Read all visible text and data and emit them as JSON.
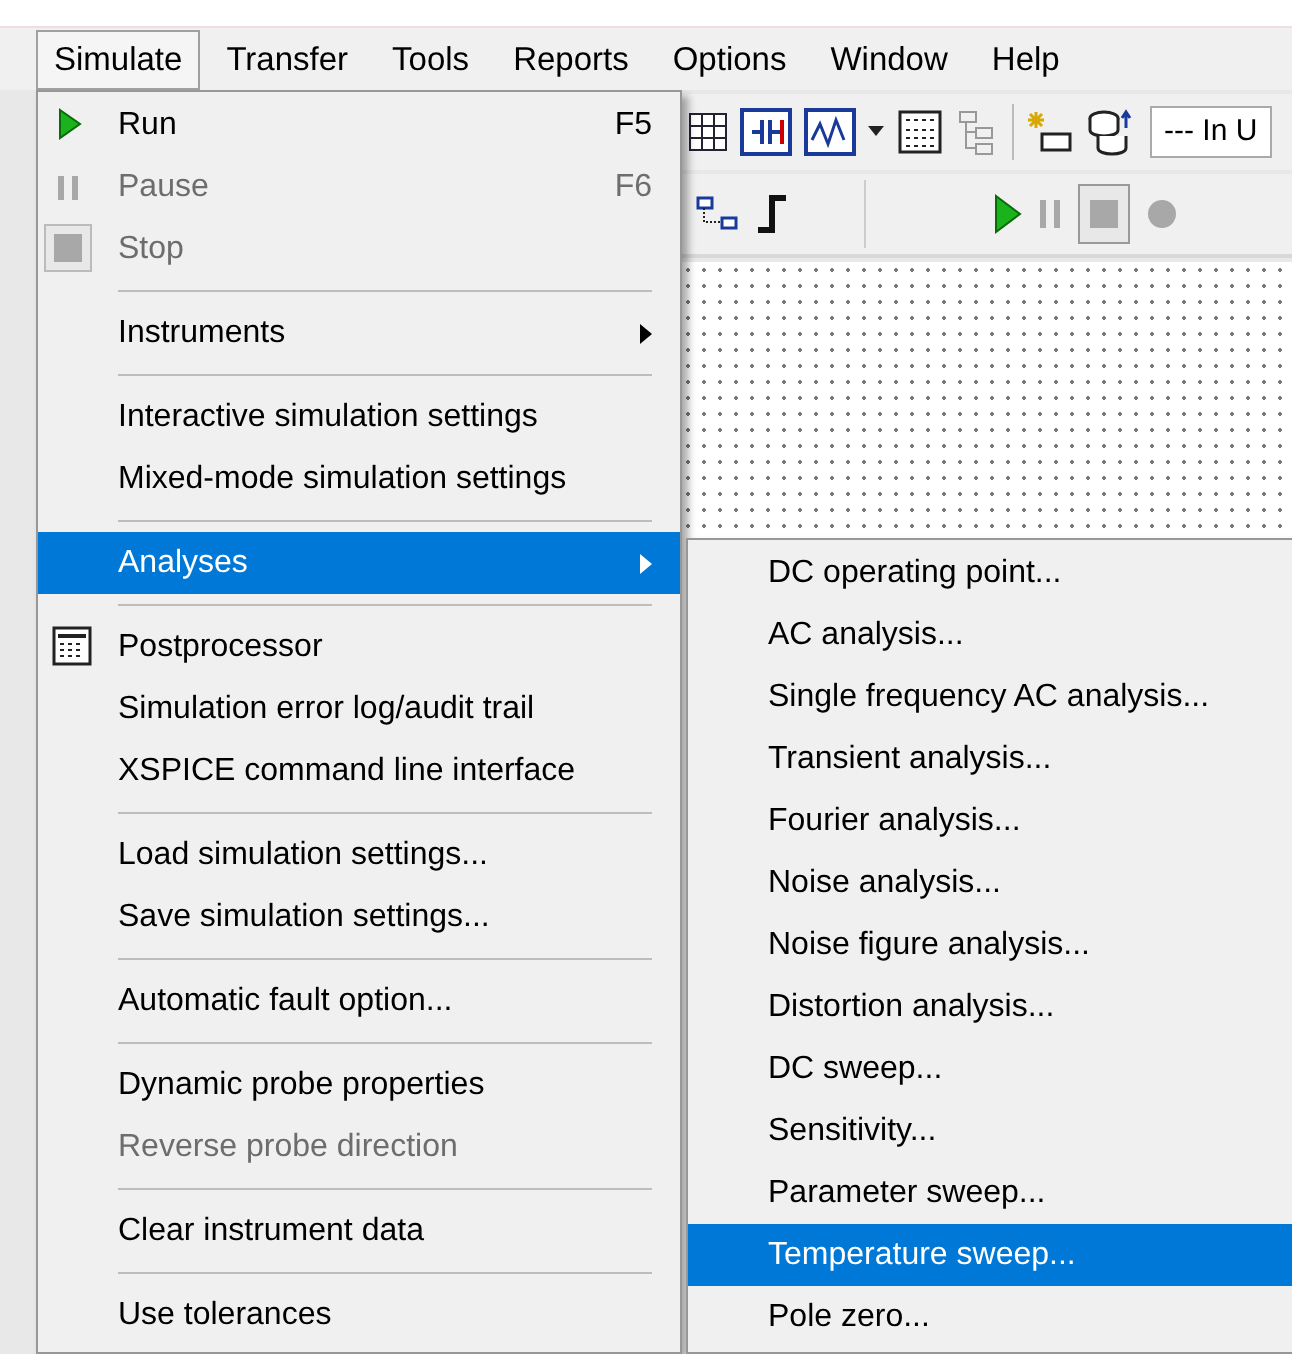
{
  "menubar": [
    {
      "label": "Simulate",
      "selected": true
    },
    {
      "label": "Transfer",
      "selected": false
    },
    {
      "label": "Tools",
      "selected": false
    },
    {
      "label": "Reports",
      "selected": false
    },
    {
      "label": "Options",
      "selected": false
    },
    {
      "label": "Window",
      "selected": false
    },
    {
      "label": "Help",
      "selected": false
    }
  ],
  "toolbar": {
    "dropdown": "--- In U"
  },
  "menu": {
    "items": [
      {
        "kind": "run",
        "label": "Run",
        "shortcut": "F5",
        "disabled": false,
        "selected": false
      },
      {
        "kind": "pause",
        "label": "Pause",
        "shortcut": "F6",
        "disabled": true,
        "selected": false
      },
      {
        "kind": "stop",
        "label": "Stop",
        "disabled": true,
        "selected": false
      },
      {
        "kind": "separator"
      },
      {
        "kind": "submenu",
        "label": "Instruments",
        "disabled": false,
        "selected": false
      },
      {
        "kind": "separator"
      },
      {
        "kind": "item",
        "label": "Interactive simulation settings",
        "disabled": false,
        "selected": false
      },
      {
        "kind": "item",
        "label": "Mixed-mode simulation settings",
        "disabled": false,
        "selected": false
      },
      {
        "kind": "separator"
      },
      {
        "kind": "submenu",
        "label": "Analyses",
        "disabled": false,
        "selected": true
      },
      {
        "kind": "separator"
      },
      {
        "kind": "calculator",
        "label": "Postprocessor",
        "disabled": false,
        "selected": false
      },
      {
        "kind": "item",
        "label": "Simulation error log/audit trail",
        "disabled": false,
        "selected": false
      },
      {
        "kind": "item",
        "label": "XSPICE command line interface",
        "disabled": false,
        "selected": false
      },
      {
        "kind": "separator"
      },
      {
        "kind": "item",
        "label": "Load simulation settings...",
        "disabled": false,
        "selected": false
      },
      {
        "kind": "item",
        "label": "Save simulation settings...",
        "disabled": false,
        "selected": false
      },
      {
        "kind": "separator"
      },
      {
        "kind": "item",
        "label": "Automatic fault option...",
        "disabled": false,
        "selected": false
      },
      {
        "kind": "separator"
      },
      {
        "kind": "item",
        "label": "Dynamic probe properties",
        "disabled": false,
        "selected": false
      },
      {
        "kind": "item",
        "label": "Reverse probe direction",
        "disabled": true,
        "selected": false
      },
      {
        "kind": "separator"
      },
      {
        "kind": "item",
        "label": "Clear instrument data",
        "disabled": false,
        "selected": false
      },
      {
        "kind": "separator"
      },
      {
        "kind": "item",
        "label": "Use tolerances",
        "disabled": false,
        "selected": false
      }
    ]
  },
  "submenu": {
    "items": [
      {
        "label": "DC operating point...",
        "selected": false
      },
      {
        "label": "AC analysis...",
        "selected": false
      },
      {
        "label": "Single frequency AC analysis...",
        "selected": false
      },
      {
        "label": "Transient analysis...",
        "selected": false
      },
      {
        "label": "Fourier analysis...",
        "selected": false
      },
      {
        "label": "Noise analysis...",
        "selected": false
      },
      {
        "label": "Noise figure analysis...",
        "selected": false
      },
      {
        "label": "Distortion analysis...",
        "selected": false
      },
      {
        "label": "DC sweep...",
        "selected": false
      },
      {
        "label": "Sensitivity...",
        "selected": false
      },
      {
        "label": "Parameter sweep...",
        "selected": false
      },
      {
        "label": "Temperature sweep...",
        "selected": true
      },
      {
        "label": "Pole zero...",
        "selected": false
      }
    ]
  }
}
